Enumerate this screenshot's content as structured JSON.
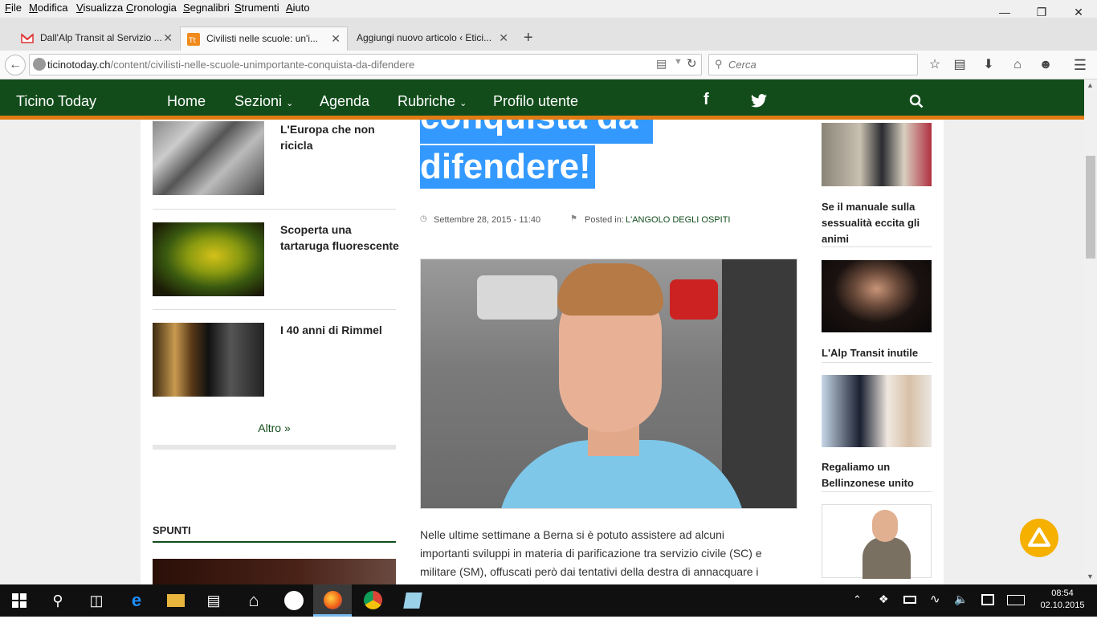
{
  "menubar": {
    "items": [
      "File",
      "Modifica",
      "Visualizza",
      "Cronologia",
      "Segnalibri",
      "Strumenti",
      "Aiuto"
    ]
  },
  "tabs": [
    {
      "title": "Dall'Alp Transit al Servizio ..."
    },
    {
      "title": "Civilisti nelle scuole: un'i..."
    },
    {
      "title": "Aggiungi nuovo articolo ‹ Etici..."
    }
  ],
  "address": {
    "domain": "ticinotoday.ch",
    "path": "/content/civilisti-nelle-scuole-unimportante-conquista-da-difendere"
  },
  "search": {
    "placeholder": "Cerca"
  },
  "site": {
    "brand": "Ticino Today",
    "nav": [
      "Home",
      "Sezioni",
      "Agenda",
      "Rubriche",
      "Profilo utente"
    ],
    "social": {
      "facebook": "f"
    }
  },
  "left": {
    "items": [
      {
        "title": "L'Europa che non ricicla"
      },
      {
        "title": "Scoperta una tartaruga fluorescente"
      },
      {
        "title": "I 40 anni di Rimmel"
      }
    ],
    "more": "Altro »",
    "section": "SPUNTI"
  },
  "article": {
    "title_lines": [
      "conquista da",
      "difendere!"
    ],
    "date": "Settembre 28, 2015 - 11:40",
    "posted_label": "Posted in:",
    "category": "L'ANGOLO DEGLI OSPITI",
    "body": [
      "Nelle ultime settimane a Berna si è potuto assistere ad alcuni",
      "importanti sviluppi in materia di parificazione tra servizio civile (SC) e",
      "militare (SM), offuscati però dai tentativi della destra di annacquare i"
    ]
  },
  "right": {
    "items": [
      {
        "title": "Se il manuale sulla sessualità eccita gli animi"
      },
      {
        "title": "L'Alp Transit inutile"
      },
      {
        "title": "Regaliamo un Bellinzonese unito"
      }
    ]
  },
  "taskbar": {
    "time": "08:54",
    "date": "02.10.2015"
  },
  "colors": {
    "site_green": "#124c1b",
    "accent_orange": "#e07b12",
    "selection_blue": "#3399ff",
    "fab_yellow": "#f5b000"
  }
}
